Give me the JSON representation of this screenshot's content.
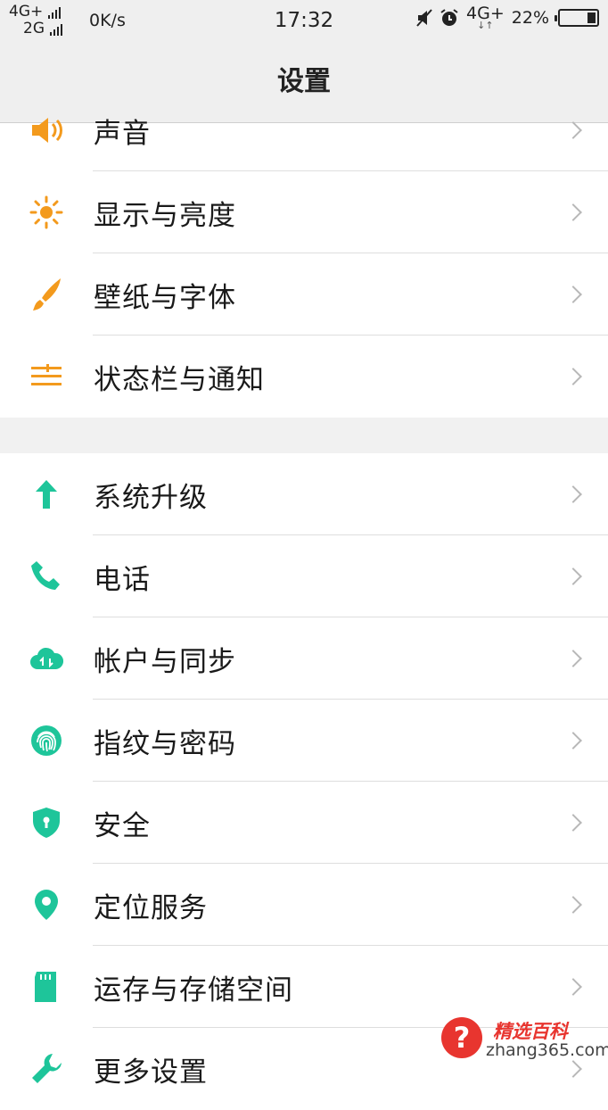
{
  "status_bar": {
    "net1": "4G+",
    "net2": "2G",
    "speed": "0K/s",
    "time": "17:32",
    "net3": "4G+",
    "battery_percent": "22%",
    "battery_level": 0.22,
    "icons": [
      "signal-icon",
      "mute-icon",
      "alarm-icon",
      "battery-icon"
    ]
  },
  "header": {
    "title": "设置"
  },
  "section1": [
    {
      "label": "声音",
      "icon": "speaker-icon",
      "color": "#f39a1d"
    },
    {
      "label": "显示与亮度",
      "icon": "sun-icon",
      "color": "#f39a1d"
    },
    {
      "label": "壁纸与字体",
      "icon": "brush-icon",
      "color": "#f39a1d"
    },
    {
      "label": "状态栏与通知",
      "icon": "notification-bar-icon",
      "color": "#f39a1d"
    }
  ],
  "section2": [
    {
      "label": "系统升级",
      "icon": "arrow-up-icon",
      "color": "#1ec59a"
    },
    {
      "label": "电话",
      "icon": "phone-icon",
      "color": "#1ec59a"
    },
    {
      "label": "帐户与同步",
      "icon": "cloud-sync-icon",
      "color": "#1ec59a"
    },
    {
      "label": "指纹与密码",
      "icon": "fingerprint-icon",
      "color": "#1ec59a"
    },
    {
      "label": "安全",
      "icon": "shield-icon",
      "color": "#1ec59a"
    },
    {
      "label": "定位服务",
      "icon": "location-pin-icon",
      "color": "#1ec59a"
    },
    {
      "label": "运存与存储空间",
      "icon": "sd-card-icon",
      "color": "#1ec59a"
    },
    {
      "label": "更多设置",
      "icon": "wrench-icon",
      "color": "#1ec59a"
    }
  ],
  "watermark": {
    "symbol": "?",
    "name": "精选百科",
    "url": "zhang365.com"
  }
}
